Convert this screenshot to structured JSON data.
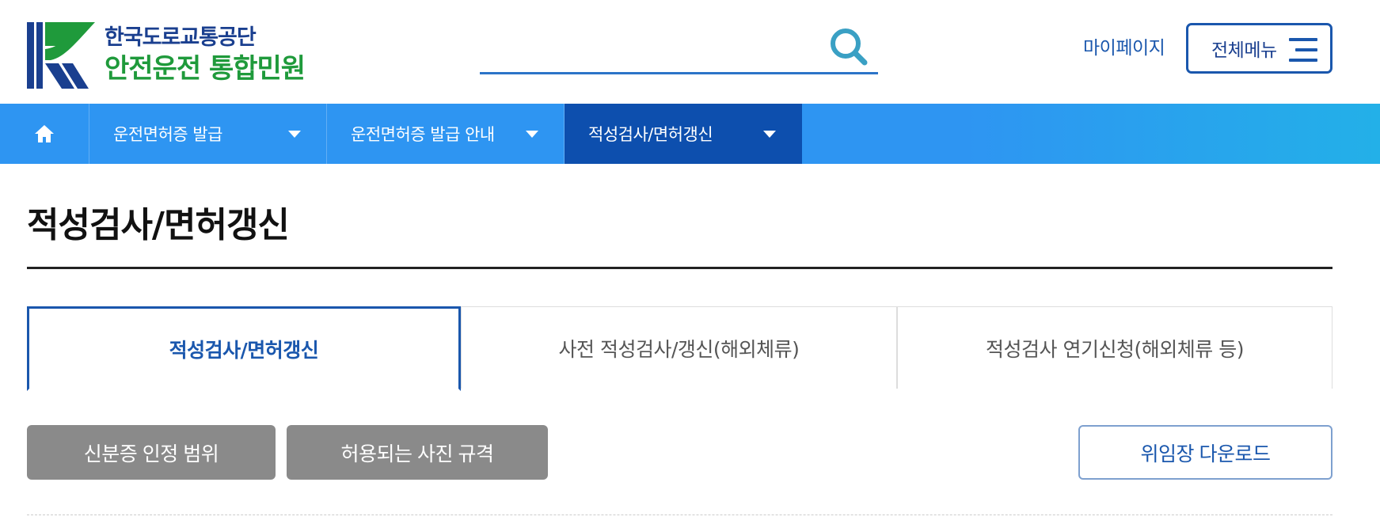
{
  "header": {
    "logo": {
      "org_name": "한국도로교통공단",
      "service_name": "안전운전 통합민원"
    },
    "search": {
      "value": "",
      "placeholder": ""
    },
    "mypage_label": "마이페이지",
    "allmenu_label": "전체메뉴"
  },
  "nav": {
    "home_icon": "home-icon",
    "items": [
      {
        "label": "운전면허증 발급",
        "active": false
      },
      {
        "label": "운전면허증 발급 안내",
        "active": false
      },
      {
        "label": "적성검사/면허갱신",
        "active": true
      }
    ]
  },
  "page": {
    "title": "적성검사/면허갱신"
  },
  "tabs": [
    {
      "label": "적성검사/면허갱신",
      "active": true
    },
    {
      "label": "사전 적성검사/갱신(해외체류)",
      "active": false
    },
    {
      "label": "적성검사 연기신청(해외체류 등)",
      "active": false
    }
  ],
  "actions": {
    "id_scope_label": "신분증 인정 범위",
    "photo_spec_label": "허용되는 사진 규격",
    "proxy_download_label": "위임장 다운로드"
  },
  "colors": {
    "brand_blue": "#1a57ad",
    "nav_blue": "#2e95f2",
    "nav_active": "#0d4fae",
    "logo_green": "#1f9a3b",
    "button_gray": "#8a8a8a"
  }
}
